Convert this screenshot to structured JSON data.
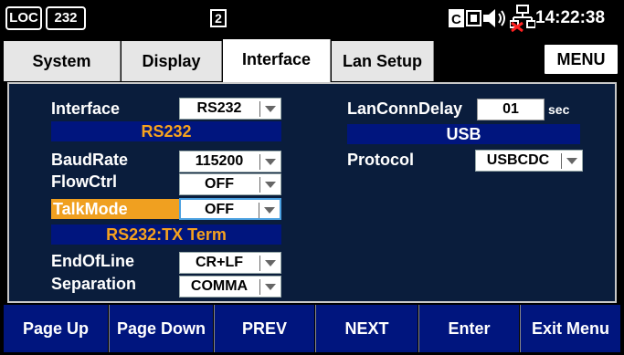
{
  "status": {
    "loc": "LOC",
    "port": "232",
    "slot": "2",
    "time": "14:22:38",
    "icons": [
      "ce-icon",
      "keylock-icon",
      "speaker-icon",
      "network-disconnected-icon"
    ]
  },
  "tabs": [
    {
      "label": "System",
      "active": false
    },
    {
      "label": "Display",
      "active": false
    },
    {
      "label": "Interface",
      "active": true
    },
    {
      "label": "Lan Setup",
      "active": false
    }
  ],
  "menu_label": "MENU",
  "left": {
    "interface": {
      "label": "Interface",
      "value": "RS232"
    },
    "section_title": "RS232",
    "baudrate": {
      "label": "BaudRate",
      "value": "115200"
    },
    "flowctrl": {
      "label": "FlowCtrl",
      "value": "OFF"
    },
    "talkmode": {
      "label": "TalkMode",
      "value": "OFF"
    },
    "info_bar": "RS232:TX Term",
    "endofline": {
      "label": "EndOfLine",
      "value": "CR+LF"
    },
    "separation": {
      "label": "Separation",
      "value": "COMMA"
    }
  },
  "right": {
    "lanconndelay": {
      "label": "LanConnDelay",
      "value": "01",
      "unit": "sec"
    },
    "section_title": "USB",
    "protocol": {
      "label": "Protocol",
      "value": "USBCDC"
    }
  },
  "softkeys": [
    "Page Up",
    "Page Down",
    "PREV",
    "NEXT",
    "Enter",
    "Exit Menu"
  ],
  "colors": {
    "panel_bg": "#0a1d3c",
    "bar_blue": "#00157e",
    "highlight_orange": "#f0a020",
    "network_red": "#ff2020"
  }
}
